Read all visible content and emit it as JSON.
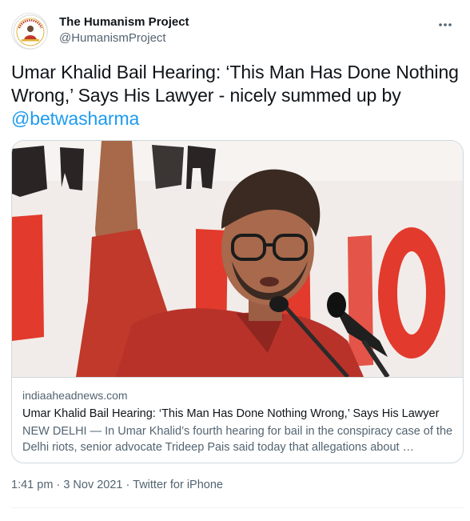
{
  "author": {
    "display_name": "The Humanism Project",
    "handle": "@HumanismProject",
    "avatar_icon": "humanism-project-logo",
    "avatar_text": "THE HUMANISM PROJECT"
  },
  "tweet": {
    "text_before": "Umar Khalid Bail Hearing: ‘This Man Has Done Nothing Wrong,’ Says His Lawyer - nicely summed up by ",
    "mention": "@betwasharma"
  },
  "card": {
    "domain": "indiaaheadnews.com",
    "title": "Umar Khalid Bail Hearing: ‘This Man Has Done Nothing Wrong,’ Says His Lawyer",
    "description": "NEW DELHI — In Umar Khalid’s fourth hearing for bail in the conspiracy case of the Delhi riots, senior advocate Trideep Pais said today that allegations about …",
    "image_icon": "news-photo-speaker-at-microphone"
  },
  "meta": {
    "time": "1:41 pm",
    "separator": "·",
    "date": "3 Nov 2021",
    "source": "Twitter for iPhone"
  },
  "colors": {
    "text": "#0f1419",
    "secondary": "#536471",
    "link": "#1d9bf0",
    "border": "#cfd9de"
  }
}
